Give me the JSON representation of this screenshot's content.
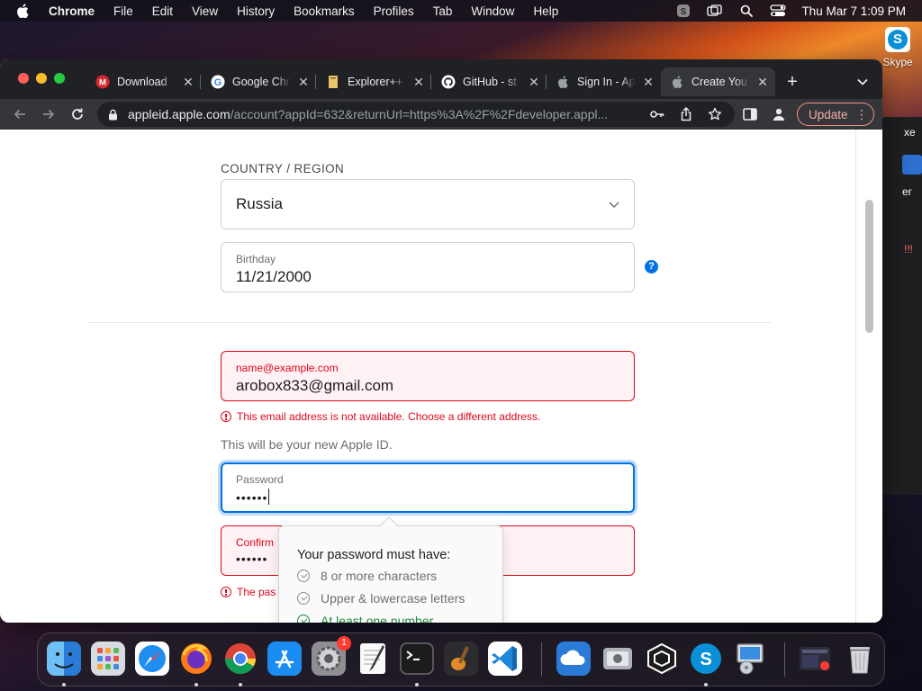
{
  "menubar": {
    "app_name": "Chrome",
    "items": [
      "File",
      "Edit",
      "View",
      "History",
      "Bookmarks",
      "Profiles",
      "Tab",
      "Window",
      "Help"
    ],
    "clock": "Thu Mar 7  1:09 PM"
  },
  "desktop": {
    "skype_label": "Skype",
    "bg_window_text1": "xe",
    "bg_window_text2": "er",
    "bg_window_text3": "!!!"
  },
  "tabs": [
    {
      "title": "Download",
      "icon": "mega-icon"
    },
    {
      "title": "Google Chr",
      "icon": "google-icon"
    },
    {
      "title": "Explorer++",
      "icon": "explorer-icon"
    },
    {
      "title": "GitHub - st",
      "icon": "github-icon"
    },
    {
      "title": "Sign In - Ap",
      "icon": "apple-icon"
    },
    {
      "title": "Create You",
      "icon": "apple-icon"
    }
  ],
  "toolbar": {
    "url_host": "appleid.apple.com",
    "url_path": "/account?appId=632&returnUrl=https%3A%2F%2Fdeveloper.appl...",
    "update_label": "Update"
  },
  "form": {
    "country_label": "COUNTRY / REGION",
    "country_value": "Russia",
    "birthday_label": "Birthday",
    "birthday_value": "11/21/2000",
    "help_glyph": "?",
    "email_label": "name@example.com",
    "email_value": "arobox833@gmail.com",
    "email_error": "This email address is not available. Choose a different address.",
    "apple_id_hint": "This will be your new Apple ID.",
    "password_label": "Password",
    "password_value": "••••••",
    "confirm_label": "Confirm",
    "confirm_value": "••••••",
    "confirm_error": "The pas"
  },
  "password_popover": {
    "title": "Your password must have:",
    "rules": [
      {
        "text": "8 or more characters",
        "met": false
      },
      {
        "text": "Upper & lowercase letters",
        "met": false
      },
      {
        "text": "At least one number",
        "met": true
      }
    ]
  },
  "dock": {
    "apps": [
      "finder-icon",
      "launchpad-icon",
      "safari-icon",
      "firefox-icon",
      "chrome-icon",
      "app-store-icon",
      "system-preferences-icon",
      "textedit-icon",
      "terminal-icon",
      "garageband-icon",
      "vscode-icon",
      "icloud-icon",
      "disk-utility-icon",
      "virtualbox-icon",
      "skype-icon",
      "installer-icon",
      "screenshot-icon",
      "trash-icon"
    ],
    "settings_badge": "1"
  },
  "colors": {
    "error_red": "#de071c",
    "focus_blue": "#0071e3",
    "success_green": "#1f8a3a"
  }
}
